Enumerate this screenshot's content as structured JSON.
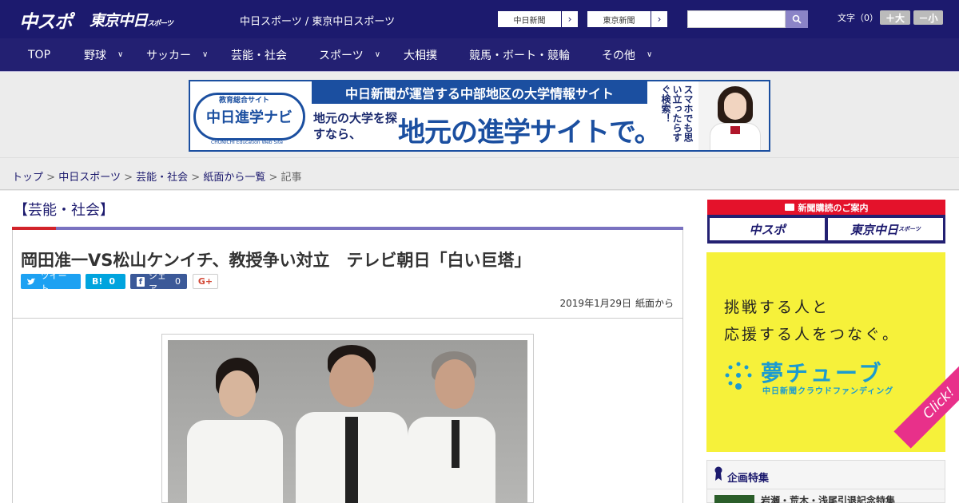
{
  "header": {
    "logo_chuspo": "中スポ",
    "logo_tokyo": "東京中日",
    "logo_tokyo_small": "スポーツ",
    "site_names": "中日スポーツ / 東京中日スポーツ",
    "site_buttons": [
      "中日新聞",
      "東京新聞"
    ],
    "search_placeholder": "",
    "font_size_label": "文字（0）",
    "font_plus": "＋大",
    "font_minus": "－小"
  },
  "nav": {
    "items": [
      {
        "label": "TOP",
        "has_menu": false
      },
      {
        "label": "野球",
        "has_menu": true
      },
      {
        "label": "サッカー",
        "has_menu": true
      },
      {
        "label": "芸能・社会",
        "has_menu": false
      },
      {
        "label": "スポーツ",
        "has_menu": true
      },
      {
        "label": "大相撲",
        "has_menu": false
      },
      {
        "label": "競馬・ボート・競輪",
        "has_menu": false
      },
      {
        "label": "その他",
        "has_menu": true
      }
    ]
  },
  "banner": {
    "logo_caption": "教育総合サイト",
    "logo_text": "中日進学ナビ",
    "logo_sub": "CHUNICHI Education Web Site",
    "headline": "中日新聞が運営する中部地区の大学情報サイト",
    "left_copy": "地元の大学を探すなら、",
    "big_copy": "地元の進学サイトで。",
    "vertical_copy": "スマホでも思い立ったらすぐ検索！"
  },
  "breadcrumb": {
    "items": [
      "トップ",
      "中日スポーツ",
      "芸能・社会",
      "紙面から一覧"
    ],
    "current": "記事",
    "separator": ">"
  },
  "article": {
    "category": "【芸能・社会】",
    "headline": "岡田准一VS松山ケンイチ、教授争い対立　テレビ朝日「白い巨塔」",
    "share": {
      "tweet": "ツイート",
      "hatena": "B!",
      "hatena_count": "0",
      "fb_share": "シェア",
      "fb_count": "0",
      "gplus": "G+"
    },
    "date": "2019年1月29日",
    "source": "紙面から"
  },
  "sidebar": {
    "subscribe_header": "新聞購読のご案内",
    "subscribe_chuspo": "中スポ",
    "subscribe_tokyo": "東京中日",
    "subscribe_tokyo_small": "スポーツ",
    "ad_line1": "挑戦する人と",
    "ad_line2": "応援する人をつなぐ。",
    "ad_logo": "夢チューブ",
    "ad_sub": "中日新聞クラウドファンディング",
    "ad_click": "Click!",
    "feature_title": "企画特集",
    "feature_item": "岩瀬・荒木・浅尾引退記念特集"
  },
  "colors": {
    "header_bg": "#1c1a6e",
    "nav_bg": "#232072",
    "accent_red": "#d2232a",
    "banner_blue": "#1b4fa0",
    "ad_yellow": "#f6f13a",
    "ad_pink": "#e8308a",
    "twitter_blue": "#1da1f2",
    "hatena_blue": "#00a4de",
    "facebook_blue": "#3b5998"
  }
}
